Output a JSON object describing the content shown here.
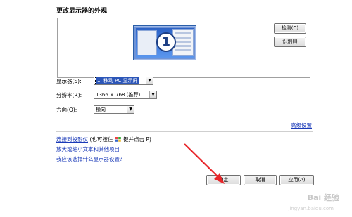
{
  "dialog": {
    "title": "更改显示器的外观"
  },
  "preview": {
    "monitor_number": "1",
    "detect_button": "检测(C)",
    "identify_button": "识别(I)"
  },
  "fields": {
    "display_label": "显示器(S):",
    "display_value": "1. 移动 PC 显示屏",
    "resolution_label": "分辨率(R):",
    "resolution_value": "1366 × 768 (推荐)",
    "orientation_label": "方向(O):",
    "orientation_value": "横向"
  },
  "advanced_link": "高级设置",
  "links": {
    "projector_prefix": "连接到投影仪",
    "projector_hint_a": "(也可按住",
    "projector_hint_b": "键并点击 P)",
    "text_size": "放大或缩小文本和其他项目",
    "which_settings": "我应该选择什么显示器设置?"
  },
  "footer": {
    "ok_button": "确定",
    "cancel_button": "取消",
    "apply_button": "应用(A)"
  },
  "watermark": {
    "brand": "Bai 经验",
    "url": "jingyan.baidu.com"
  },
  "colors": {
    "annotation_arrow": "#e8262a",
    "link": "#1a3ab8"
  },
  "icons": {
    "windows_key": "windows-logo-icon"
  }
}
